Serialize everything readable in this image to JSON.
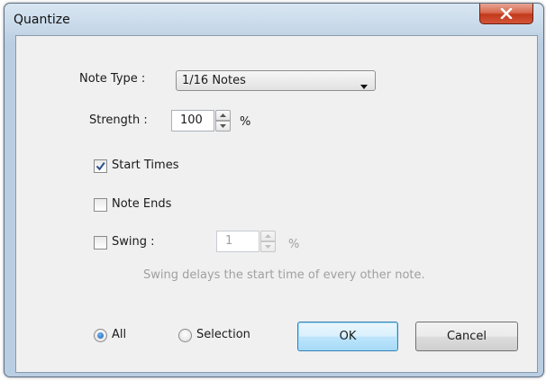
{
  "window": {
    "title": "Quantize",
    "close_icon": "close-icon"
  },
  "note_type": {
    "label": "Note Type :",
    "value": "1/16 Notes"
  },
  "strength": {
    "label": "Strength :",
    "value": "100",
    "unit": "%"
  },
  "start_times": {
    "label": "Start Times",
    "checked": true
  },
  "note_ends": {
    "label": "Note Ends",
    "checked": false
  },
  "swing": {
    "label": "Swing :",
    "checked": false,
    "value": "1",
    "unit": "%",
    "hint": "Swing delays the start time of every other note."
  },
  "scope": {
    "all_label": "All",
    "selection_label": "Selection",
    "selected": "All"
  },
  "buttons": {
    "ok_label": "OK",
    "cancel_label": "Cancel"
  }
}
